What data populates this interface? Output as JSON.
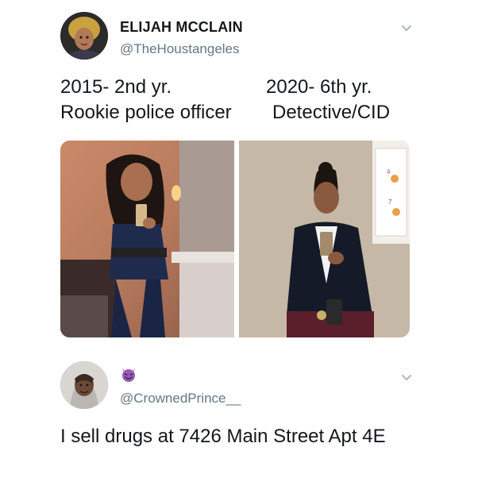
{
  "tweet1": {
    "display_name": "ELIJAH MCCLAIN",
    "handle": "@TheHoustangeles",
    "caption_left_line1": "2015- 2nd yr.",
    "caption_left_line2": "Rookie police officer",
    "caption_right_line1": "2020- 6th yr.",
    "caption_right_line2": "Detective/CID",
    "avatar_icon": "profile-photo",
    "menu_icon": "chevron-down-icon",
    "photos": [
      {
        "name": "uniform-selfie-photo"
      },
      {
        "name": "detective-selfie-photo"
      }
    ]
  },
  "tweet2": {
    "display_name_emoji": "smiling-devil-emoji",
    "handle": "@CrownedPrince__",
    "text": "I sell drugs at 7426 Main Street Apt 4E",
    "avatar_icon": "profile-photo",
    "menu_icon": "chevron-down-icon"
  },
  "colors": {
    "text_primary": "#14171a",
    "text_secondary": "#657786",
    "emoji_purple": "#9b59b6",
    "chevron": "#aab8c2"
  }
}
